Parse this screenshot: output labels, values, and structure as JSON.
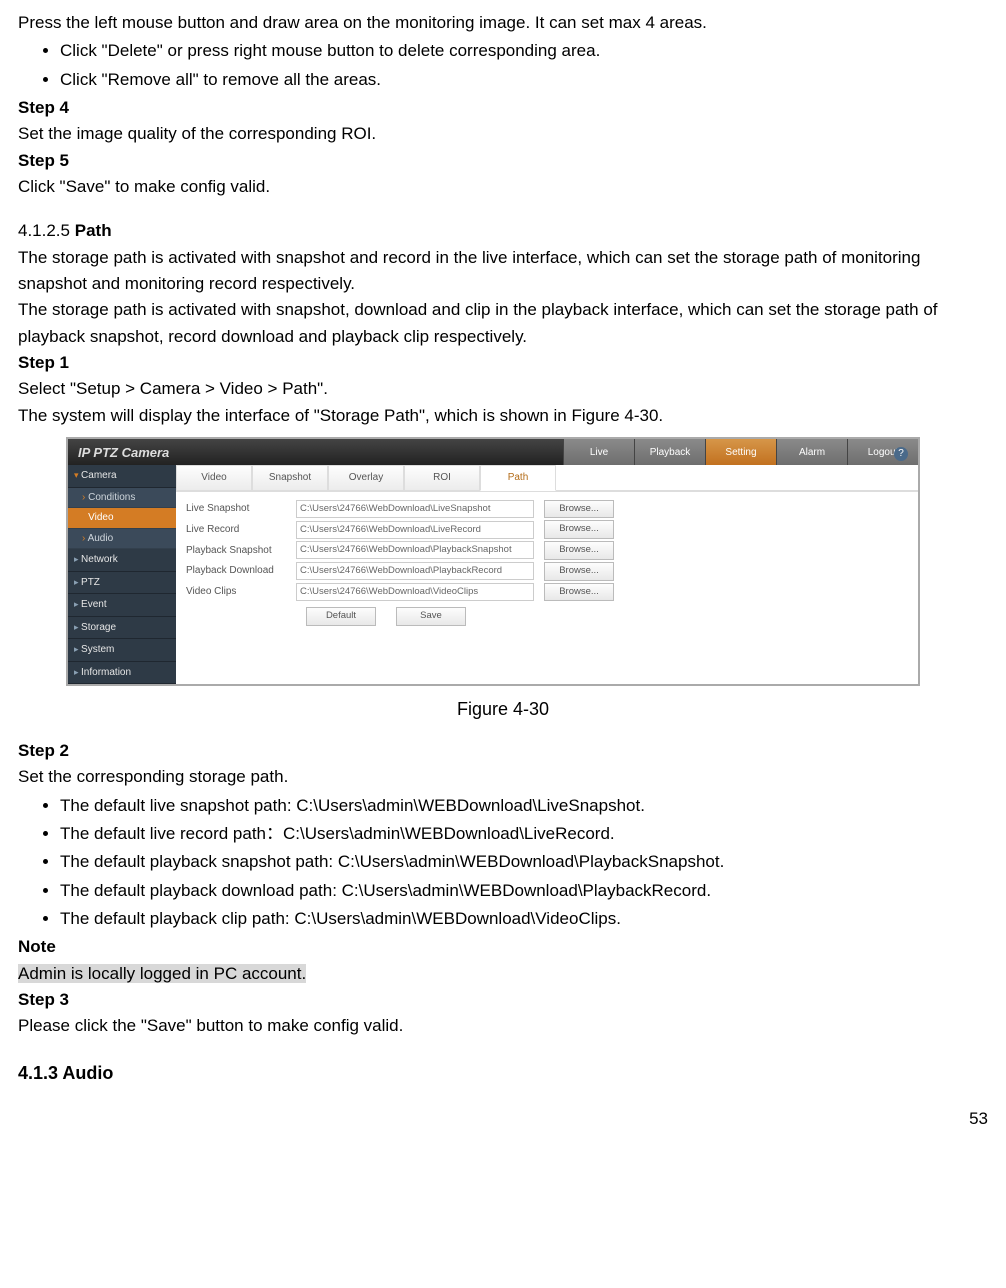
{
  "intro1": "Press the left mouse button and draw area on the monitoring image. It can set max 4 areas.",
  "bul1a": "Click \"Delete\" or press right mouse button to delete corresponding area.",
  "bul1b": "Click \"Remove all\" to remove all the areas.",
  "step4": "Step 4",
  "step4_txt": "Set the image quality of the corresponding ROI.",
  "step5": "Step 5",
  "step5_txt": "Click \"Save\" to make config valid.",
  "sec_num": "4.1.2.5",
  "sec_title": "Path",
  "path_p1": "The storage path is activated with snapshot and record in the live interface, which can set the storage path of monitoring snapshot and monitoring record respectively.",
  "path_p2": "The storage path is activated with snapshot, download and clip in the playback interface, which can set the storage path of playback snapshot, record download and playback clip respectively.",
  "step1": "Step 1",
  "step1_txt": "Select \"Setup > Camera > Video > Path\".",
  "step1_txt2": "The system will display the interface of \"Storage Path\", which is shown in Figure 4-30.",
  "fig": {
    "title": "IP PTZ Camera",
    "nav": {
      "live": "Live",
      "playback": "Playback",
      "setting": "Setting",
      "alarm": "Alarm",
      "logout": "Logout"
    },
    "side": {
      "camera": "Camera",
      "conditions": "Conditions",
      "video": "Video",
      "audio": "Audio",
      "network": "Network",
      "ptz": "PTZ",
      "event": "Event",
      "storage": "Storage",
      "system": "System",
      "information": "Information"
    },
    "tabs": {
      "video": "Video",
      "snapshot": "Snapshot",
      "overlay": "Overlay",
      "roi": "ROI",
      "path": "Path"
    },
    "rows": {
      "r1l": "Live Snapshot",
      "r1v": "C:\\Users\\24766\\WebDownload\\LiveSnapshot",
      "r2l": "Live Record",
      "r2v": "C:\\Users\\24766\\WebDownload\\LiveRecord",
      "r3l": "Playback Snapshot",
      "r3v": "C:\\Users\\24766\\WebDownload\\PlaybackSnapshot",
      "r4l": "Playback Download",
      "r4v": "C:\\Users\\24766\\WebDownload\\PlaybackRecord",
      "r5l": "Video Clips",
      "r5v": "C:\\Users\\24766\\WebDownload\\VideoClips"
    },
    "browse": "Browse...",
    "default_btn": "Default",
    "save_btn": "Save",
    "help": "?"
  },
  "caption": "Figure 4-30",
  "step2": "Step 2",
  "step2_txt": "Set the corresponding storage path.",
  "b1": "The default live snapshot path: C:\\Users\\admin\\WEBDownload\\LiveSnapshot.",
  "b2": "The default live record path：C:\\Users\\admin\\WEBDownload\\LiveRecord.",
  "b3": "The default playback snapshot path: C:\\Users\\admin\\WEBDownload\\PlaybackSnapshot.",
  "b4": "The default playback download path: C:\\Users\\admin\\WEBDownload\\PlaybackRecord.",
  "b5": "The default playback clip path: C:\\Users\\admin\\WEBDownload\\VideoClips.",
  "note": "Note",
  "note_txt": "Admin is locally logged in PC account.",
  "step3": "Step 3",
  "step3_txt": "Please click the \"Save\" button to make config valid.",
  "sec2": "4.1.3  Audio",
  "page": "53"
}
